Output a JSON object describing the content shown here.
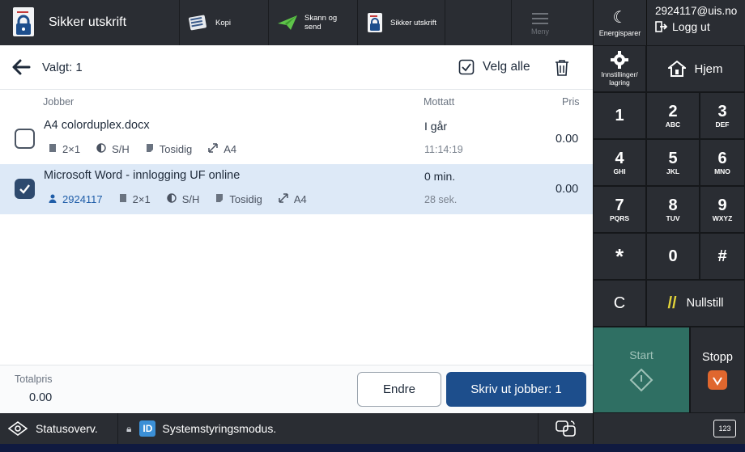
{
  "topbar": {
    "app_title": "Sikker utskrift",
    "shortcuts": [
      {
        "label": "Kopi",
        "icon": "copy-icon"
      },
      {
        "label": "Skann og send",
        "icon": "scan-send-icon"
      },
      {
        "label": "Sikker utskrift",
        "icon": "secure-print-icon"
      }
    ],
    "menu_label": "Meny",
    "energy_label": "Energisparer",
    "user": "2924117@uis.no",
    "logout_label": "Logg ut"
  },
  "header": {
    "selected_label": "Valgt: 1",
    "select_all_label": "Velg alle"
  },
  "columns": {
    "jobs": "Jobber",
    "received": "Mottatt",
    "price": "Pris"
  },
  "jobs": [
    {
      "name": "A4 colorduplex.docx",
      "selected": false,
      "layout": "2×1",
      "color": "S/H",
      "sides": "Tosidig",
      "paper": "A4",
      "received_line1": "I går",
      "received_line2": "11:14:19",
      "price": "0.00"
    },
    {
      "name": "Microsoft Word - innlogging UF online",
      "selected": true,
      "owner": "2924117",
      "layout": "2×1",
      "color": "S/H",
      "sides": "Tosidig",
      "paper": "A4",
      "received_line1": "0 min.",
      "received_line2": "28 sek.",
      "price": "0.00"
    }
  ],
  "footer": {
    "total_label": "Totalpris",
    "total_value": "0.00",
    "edit_label": "Endre",
    "print_label": "Skriv ut jobber: 1"
  },
  "statusbar": {
    "status_label": "Statusoverv.",
    "id_badge": "ID",
    "mode_label": "Systemstyringsmodus."
  },
  "keypad": {
    "settings_label": "Innstillinger/ lagring",
    "home_label": "Hjem",
    "keys": [
      {
        "digit": "1",
        "letters": ""
      },
      {
        "digit": "2",
        "letters": "ABC"
      },
      {
        "digit": "3",
        "letters": "DEF"
      },
      {
        "digit": "4",
        "letters": "GHI"
      },
      {
        "digit": "5",
        "letters": "JKL"
      },
      {
        "digit": "6",
        "letters": "MNO"
      },
      {
        "digit": "7",
        "letters": "PQRS"
      },
      {
        "digit": "8",
        "letters": "TUV"
      },
      {
        "digit": "9",
        "letters": "WXYZ"
      },
      {
        "digit": "*",
        "letters": ""
      },
      {
        "digit": "0",
        "letters": ""
      },
      {
        "digit": "#",
        "letters": ""
      }
    ],
    "clear_label": "C",
    "reset_label": "Nullstill",
    "start_label": "Start",
    "stop_label": "Stopp",
    "keyboard_label": "123"
  },
  "colors": {
    "primary_button": "#1d4e8c",
    "selected_row": "#dde9f7",
    "start_key": "#2f6f63",
    "stop_icon": "#e0672e",
    "reset_slash": "#e3d43a"
  }
}
